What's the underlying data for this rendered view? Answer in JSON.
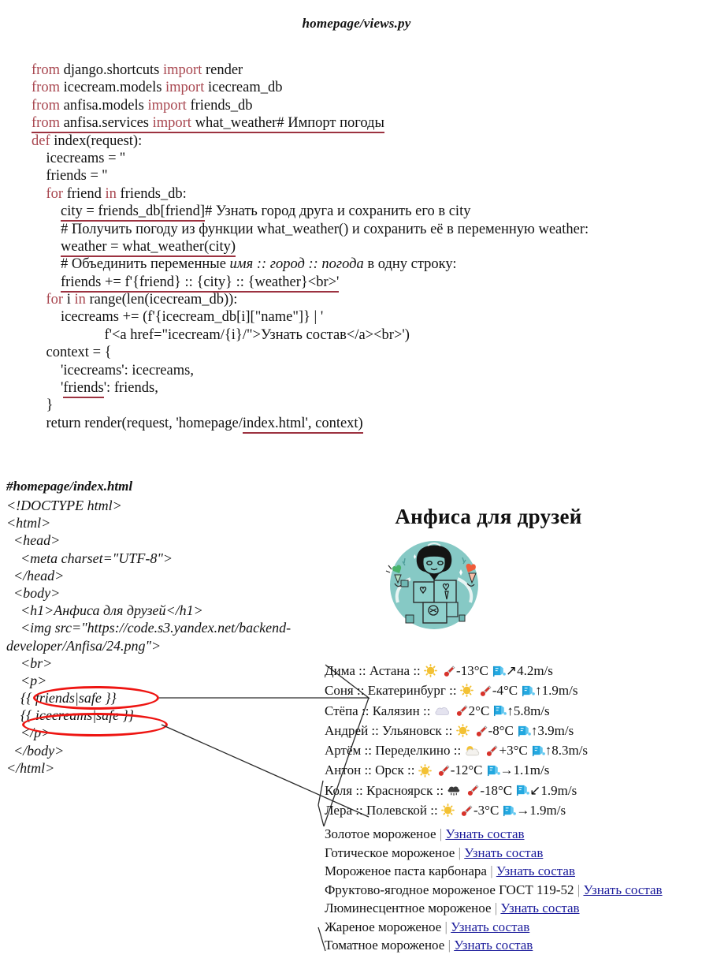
{
  "python_file": {
    "title": "homepage/views.py",
    "lines": [
      {
        "indent": 0,
        "parts": [
          {
            "t": "from ",
            "kw": true
          },
          {
            "t": "django.shortcuts "
          },
          {
            "t": "import ",
            "kw": true
          },
          {
            "t": "render"
          }
        ]
      },
      {
        "indent": 0,
        "parts": [
          {
            "t": "from ",
            "kw": true
          },
          {
            "t": "icecream.models "
          },
          {
            "t": "import ",
            "kw": true
          },
          {
            "t": "icecream_db"
          }
        ]
      },
      {
        "indent": 0,
        "parts": [
          {
            "t": "from ",
            "kw": true
          },
          {
            "t": "anfisa.models "
          },
          {
            "t": "import ",
            "kw": true
          },
          {
            "t": "friends_db"
          }
        ]
      },
      {
        "indent": 0,
        "underline": true,
        "parts": [
          {
            "t": "from ",
            "kw": true
          },
          {
            "t": "anfisa.services "
          },
          {
            "t": "import ",
            "kw": true
          },
          {
            "t": "what_weather"
          },
          {
            "t": "# Импорт погоды"
          }
        ]
      },
      {
        "indent": 0,
        "parts": [
          {
            "t": "def ",
            "kw": true
          },
          {
            "t": "index(request):"
          }
        ]
      },
      {
        "indent": 1,
        "parts": [
          {
            "t": "icecreams = ''"
          }
        ]
      },
      {
        "indent": 1,
        "parts": [
          {
            "t": "friends = ''"
          }
        ]
      },
      {
        "indent": 1,
        "parts": [
          {
            "t": "for ",
            "kw": true
          },
          {
            "t": "friend "
          },
          {
            "t": "in ",
            "kw": true
          },
          {
            "t": "friends_db:"
          }
        ]
      },
      {
        "indent": 2,
        "underline_span": "city = friends_db[friend]",
        "parts": [
          {
            "t": "city = friends_db[friend]"
          },
          {
            "t": "# Узнать город друга и сохранить его в city"
          }
        ]
      },
      {
        "indent": 2,
        "parts": [
          {
            "t": "# Получить погоду из функции what_weather() и сохранить её в переменную weather:"
          }
        ]
      },
      {
        "indent": 2,
        "underline": true,
        "parts": [
          {
            "t": "weather = what_weather(city)"
          }
        ]
      },
      {
        "indent": 2,
        "parts": [
          {
            "t": "# Объединить переменные "
          },
          {
            "t": "имя :: город :: погода",
            "it": true
          },
          {
            "t": " в одну строку:"
          }
        ]
      },
      {
        "indent": 2,
        "underline": true,
        "parts": [
          {
            "t": "friends += f'{friend} :: {city} :: {weather}<br>'"
          }
        ]
      },
      {
        "indent": 1,
        "parts": [
          {
            "t": "for ",
            "kw": true
          },
          {
            "t": "i "
          },
          {
            "t": "in ",
            "kw": true
          },
          {
            "t": "range(len(icecream_db)):"
          }
        ]
      },
      {
        "indent": 2,
        "parts": [
          {
            "t": "icecreams += (f'{icecream_db[i][\"name\"]} | '"
          }
        ]
      },
      {
        "indent": 5,
        "parts": [
          {
            "t": "f'<a href=\"icecream/{i}/\">Узнать состав</a><br>')"
          }
        ]
      },
      {
        "indent": 1,
        "parts": [
          {
            "t": "context = {"
          }
        ]
      },
      {
        "indent": 2,
        "parts": [
          {
            "t": "'icecreams': icecreams,"
          }
        ]
      },
      {
        "indent": 2,
        "underline_word": "friends",
        "parts": [
          {
            "t": "'friends': friends,"
          }
        ]
      },
      {
        "indent": 1,
        "parts": [
          {
            "t": "}"
          }
        ]
      },
      {
        "indent": 1,
        "underline_word": "index.html', context)",
        "parts": [
          {
            "t": "return render(request, 'homepage/index.html', context)"
          }
        ]
      }
    ]
  },
  "template_file": {
    "title": "#homepage/index.html",
    "lines": [
      "<!DOCTYPE html>",
      "<html>",
      "  <head>",
      "    <meta charset=\"UTF-8\">",
      "  </head>",
      "  <body>",
      "    <h1>Анфиса для друзей</h1>",
      "    <img src=\"https://code.s3.yandex.net/backend-",
      "developer/Anfisa/24.png\">",
      "    <br>",
      "    <p>",
      "    {{ friends|safe }}",
      "    {{ icecreams|safe }}",
      "    </p>",
      "  </body>",
      "</html>"
    ],
    "highlighted": [
      "{{ friends|safe }}",
      "{{ icecreams|safe }}"
    ],
    "highlight_color": "#ee1512"
  },
  "preview": {
    "heading": "Анфиса для друзей",
    "illustration": {
      "name": "anfisa-character-illustration",
      "circle_color": "#86c9c5",
      "left_icecream_color": "#49b36a",
      "right_icecream_color": "#ef5c3a"
    },
    "friends": [
      {
        "name": "Дима",
        "city": "Астана",
        "sky": "sun",
        "temp": "-13°C",
        "wind_arrow": "↗",
        "wind": "4.2m/s"
      },
      {
        "name": "Соня",
        "city": "Екатеринбург",
        "sky": "sun",
        "temp": "-4°C",
        "wind_arrow": "↑",
        "wind": "1.9m/s"
      },
      {
        "name": "Стёпа",
        "city": "Калязин",
        "sky": "cloud",
        "temp": "2°C",
        "wind_arrow": "↑",
        "wind": "5.8m/s"
      },
      {
        "name": "Андрей",
        "city": "Ульяновск",
        "sky": "sun",
        "temp": "-8°C",
        "wind_arrow": "↑",
        "wind": "3.9m/s"
      },
      {
        "name": "Артём",
        "city": "Переделкино",
        "sky": "partly",
        "temp": "+3°C",
        "wind_arrow": "↑",
        "wind": "8.3m/s"
      },
      {
        "name": "Антон",
        "city": "Орск",
        "sky": "sun",
        "temp": "-12°C",
        "wind_arrow": "→",
        "wind": "1.1m/s"
      },
      {
        "name": "Коля",
        "city": "Красноярск",
        "sky": "rain",
        "temp": "-18°C",
        "wind_arrow": "↙",
        "wind": "1.9m/s"
      },
      {
        "name": "Лера",
        "city": "Полевской",
        "sky": "sun",
        "temp": "-3°C",
        "wind_arrow": "→",
        "wind": "1.9m/s"
      }
    ],
    "separator": "::",
    "icecreams": [
      {
        "name": "Золотое мороженое",
        "link": "Узнать состав"
      },
      {
        "name": "Готическое мороженое",
        "link": "Узнать состав"
      },
      {
        "name": "Мороженое паста карбонара",
        "link": "Узнать состав"
      },
      {
        "name": "Фруктово-ягодное мороженое ГОСТ 119-52",
        "link": "Узнать состав"
      },
      {
        "name": "Люминесцентное мороженое",
        "link": "Узнать состав"
      },
      {
        "name": "Жареное мороженое",
        "link": "Узнать состав"
      },
      {
        "name": "Томатное мороженое",
        "link": "Узнать состав"
      }
    ],
    "icecream_separator": "|",
    "link_color": "#1b1b9b"
  },
  "colors": {
    "keyword": "#a8464f",
    "underline": "#9c3240",
    "annotation_red": "#ee1512",
    "sun": "#f3c133",
    "thermometer": "#d8322a",
    "wind": "#23a8e0",
    "cloud_light": "#e4e3ef",
    "cloud_dark": "#3a3a3a"
  }
}
